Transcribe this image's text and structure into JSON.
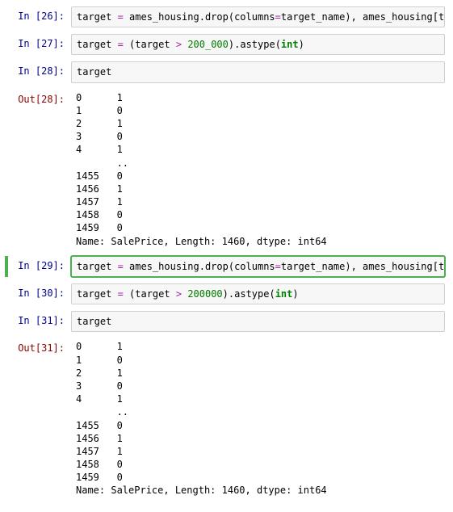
{
  "cells": [
    {
      "kind": "in",
      "n": 26,
      "code_html": "target <span class='tok-op'>=</span> ames_housing.drop(columns<span class='tok-op'>=</span>target_name), ames_housing[target_name]"
    },
    {
      "kind": "in",
      "n": 27,
      "code_html": "target <span class='tok-op'>=</span> (target <span class='tok-op'>&gt;</span> <span class='tok-num'>200_000</span>).astype(<span class='tok-kw'>int</span>)"
    },
    {
      "kind": "in",
      "n": 28,
      "code_html": "target"
    },
    {
      "kind": "out",
      "n": 28,
      "output_key": "out28"
    },
    {
      "kind": "in",
      "n": 29,
      "selected": true,
      "code_html": "target <span class='tok-op'>=</span> ames_housing.drop(columns<span class='tok-op'>=</span>target_name), ames_housing[target_name]"
    },
    {
      "kind": "in",
      "n": 30,
      "code_html": "target <span class='tok-op'>=</span> (target <span class='tok-op'>&gt;</span> <span class='tok-num'>200000</span>).astype(<span class='tok-kw'>int</span>)"
    },
    {
      "kind": "in",
      "n": 31,
      "code_html": "target"
    },
    {
      "kind": "out",
      "n": 31,
      "output_key": "out31"
    }
  ],
  "prompts": {
    "in_prefix": "In [",
    "out_prefix": "Out[",
    "suffix": "]:"
  },
  "outputs": {
    "out28": {
      "rows_top": [
        [
          "0",
          "1"
        ],
        [
          "1",
          "0"
        ],
        [
          "2",
          "1"
        ],
        [
          "3",
          "0"
        ],
        [
          "4",
          "1"
        ]
      ],
      "ellipsis": "..",
      "rows_bottom": [
        [
          "1455",
          "0"
        ],
        [
          "1456",
          "1"
        ],
        [
          "1457",
          "1"
        ],
        [
          "1458",
          "0"
        ],
        [
          "1459",
          "0"
        ]
      ],
      "footer": "Name: SalePrice, Length: 1460, dtype: int64"
    },
    "out31": {
      "rows_top": [
        [
          "0",
          "1"
        ],
        [
          "1",
          "0"
        ],
        [
          "2",
          "1"
        ],
        [
          "3",
          "0"
        ],
        [
          "4",
          "1"
        ]
      ],
      "ellipsis": "..",
      "rows_bottom": [
        [
          "1455",
          "0"
        ],
        [
          "1456",
          "1"
        ],
        [
          "1457",
          "1"
        ],
        [
          "1458",
          "0"
        ],
        [
          "1459",
          "0"
        ]
      ],
      "footer": "Name: SalePrice, Length: 1460, dtype: int64"
    }
  }
}
